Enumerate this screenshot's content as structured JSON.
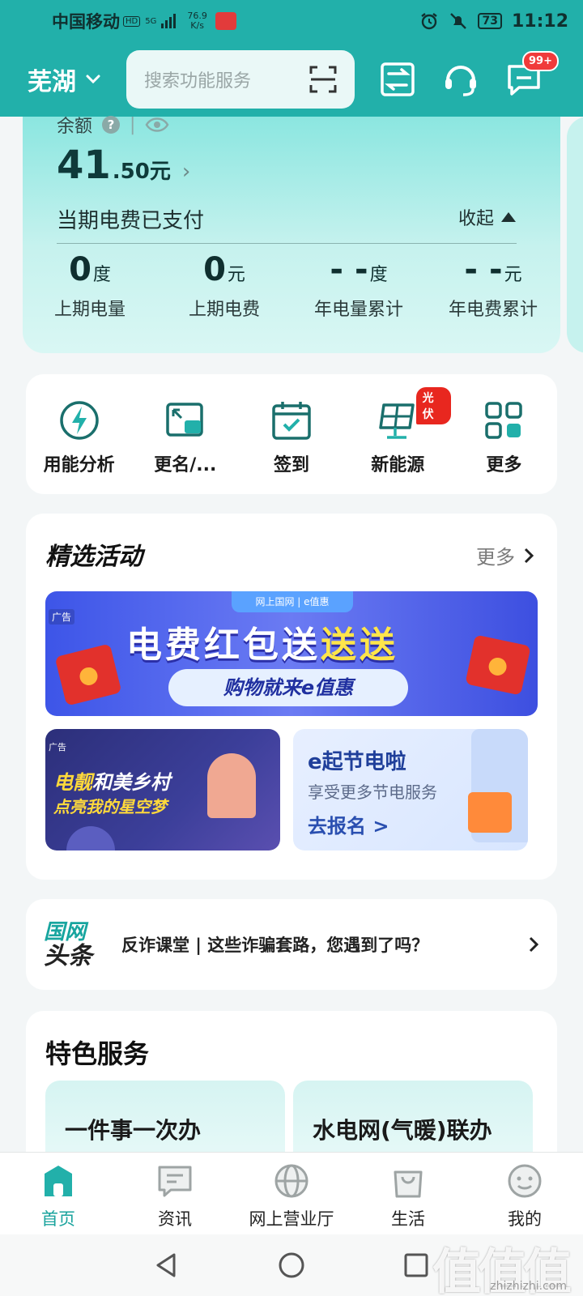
{
  "status_bar": {
    "carrier": "中国移动",
    "hd": "HD",
    "signal": "5G",
    "speed_value": "76.9",
    "speed_unit": "K/s",
    "battery": "73",
    "time": "11:12"
  },
  "header": {
    "city": "芜湖",
    "search_placeholder": "搜索功能服务",
    "message_badge": "99+"
  },
  "balance": {
    "label": "余额",
    "amount_int": "41",
    "amount_dec": ".50元",
    "status": "当期电费已支付",
    "collapse_label": "收起",
    "stats": [
      {
        "value": "0",
        "unit": "度",
        "label": "上期电量"
      },
      {
        "value": "0",
        "unit": "元",
        "label": "上期电费"
      },
      {
        "value": "- -",
        "unit": "度",
        "label": "年电量累计"
      },
      {
        "value": "- -",
        "unit": "元",
        "label": "年电费累计"
      }
    ]
  },
  "quick_actions": [
    {
      "label": "用能分析"
    },
    {
      "label": "更名/..."
    },
    {
      "label": "签到"
    },
    {
      "label": "新能源",
      "tag": "光伏"
    },
    {
      "label": "更多"
    }
  ],
  "activities": {
    "title": "精选活动",
    "more": "更多",
    "banner": {
      "ad": "广告",
      "top_tab": "网上国网  |  e值惠",
      "headline_a": "电费红包送",
      "headline_b": "送送",
      "sub": "购物就来e值惠"
    },
    "card_a": {
      "ad": "广告",
      "line1_a": "电靓",
      "line1_b": "和美乡村",
      "line2": "点亮我的星空梦"
    },
    "card_b": {
      "title": "e起节电啦",
      "subtitle": "享受更多节电服务",
      "link": "去报名 >"
    }
  },
  "news": {
    "logo_a": "国网",
    "logo_b": "头条",
    "text": "反诈课堂 | 这些诈骗套路，您遇到了吗？"
  },
  "features": {
    "title": "特色服务",
    "items": [
      {
        "label": "一件事一次办"
      },
      {
        "label": "水电网(气暖)联办"
      }
    ]
  },
  "bottom_nav": [
    {
      "label": "首页",
      "active": true
    },
    {
      "label": "资讯"
    },
    {
      "label": "网上营业厅"
    },
    {
      "label": "生活"
    },
    {
      "label": "我的"
    }
  ],
  "watermark": {
    "text": "值值值",
    "url": "zhizhizhi.com"
  },
  "colors": {
    "brand": "#22b0aa",
    "accent_red": "#e8271f"
  }
}
